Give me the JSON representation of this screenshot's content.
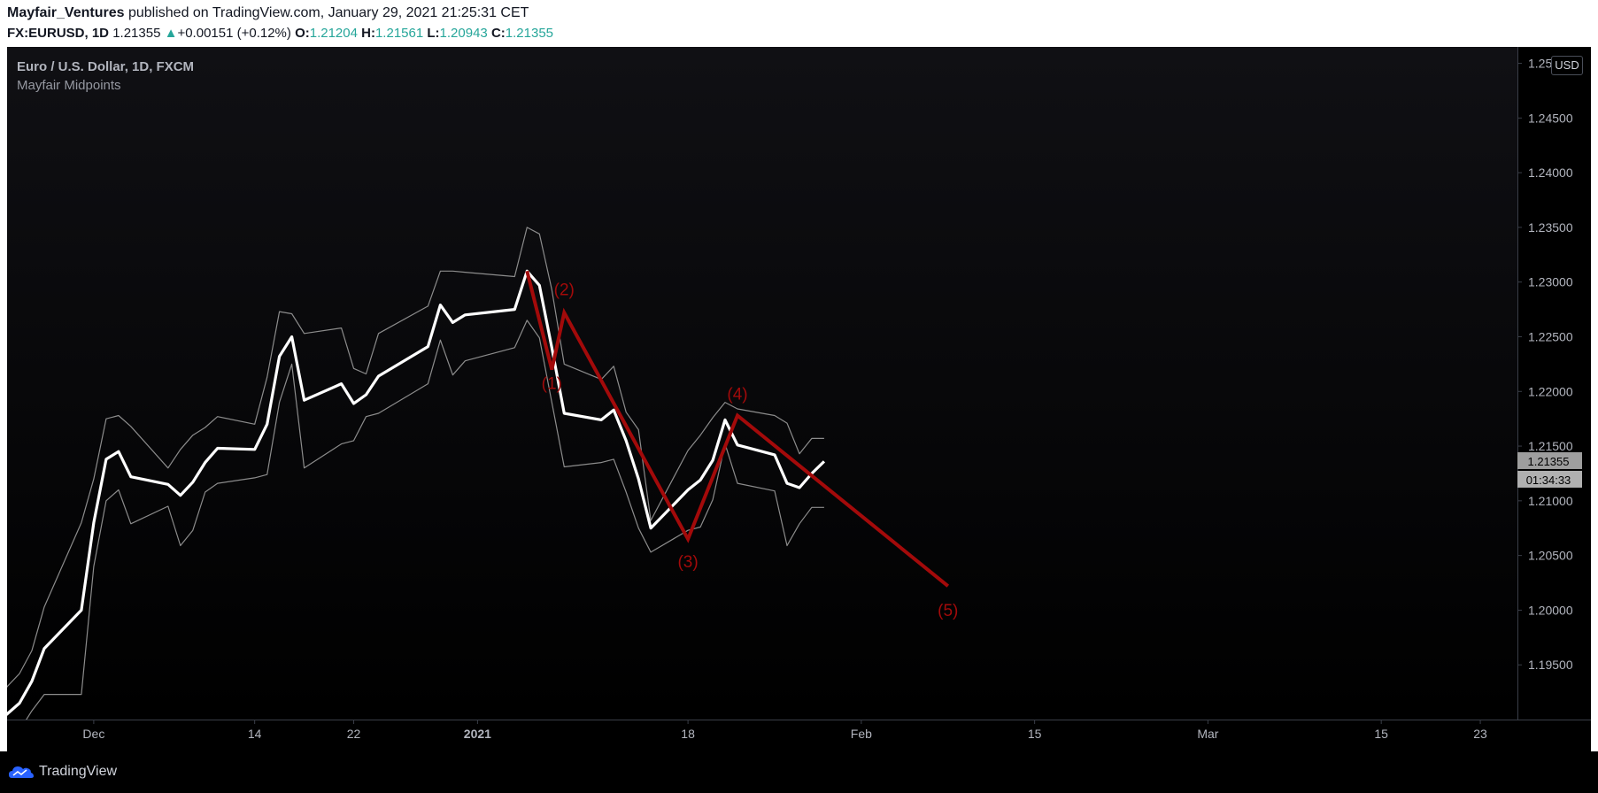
{
  "header": {
    "author": "Mayfair_Ventures",
    "published_text": " published on TradingView.com, January 29, 2021 21:25:31 CET",
    "symbol_text": "FX:EURUSD, 1D",
    "last": "1.21355",
    "change_arrow": "▲",
    "change": "+0.00151 (+0.12%)",
    "o_label": "O:",
    "o": "1.21204",
    "h_label": "H:",
    "h": "1.21561",
    "l_label": "L:",
    "l": "1.20943",
    "c_label": "C:",
    "c": "1.21355"
  },
  "legend": {
    "title": "Euro / U.S. Dollar, 1D, FXCM",
    "indicator": "Mayfair Midpoints"
  },
  "currency_badge": "USD",
  "price_label": "1.21355",
  "countdown_label": "01:34:33",
  "footer": {
    "brand": "TradingView"
  },
  "colors": {
    "background": "#000000",
    "midline": "#ffffff",
    "band": "#8c8c8c",
    "wave": "#a30a0a",
    "axis_text": "#b2b5be",
    "price_label_bg": "#9e9e9e",
    "countdown_bg": "#b0b0b0"
  },
  "chart_data": {
    "type": "line",
    "title": "",
    "xlabel": "",
    "ylabel": "",
    "ylim": [
      1.19,
      1.2515
    ],
    "date_range": [
      "2020-11-24",
      "2021-03-26"
    ],
    "y_ticks": [
      "1.19500",
      "1.20000",
      "1.20500",
      "1.21000",
      "1.21500",
      "1.22000",
      "1.22500",
      "1.23000",
      "1.23500",
      "1.24000",
      "1.24500",
      "1.25000"
    ],
    "x_ticks": [
      {
        "label": "Dec",
        "date": "2020-12-01",
        "bold": false
      },
      {
        "label": "14",
        "date": "2020-12-14",
        "bold": false
      },
      {
        "label": "22",
        "date": "2020-12-22",
        "bold": false
      },
      {
        "label": "2021",
        "date": "2021-01-01",
        "bold": true
      },
      {
        "label": "18",
        "date": "2021-01-18",
        "bold": false
      },
      {
        "label": "Feb",
        "date": "2021-02-01",
        "bold": false
      },
      {
        "label": "15",
        "date": "2021-02-15",
        "bold": false
      },
      {
        "label": "Mar",
        "date": "2021-03-01",
        "bold": false
      },
      {
        "label": "15",
        "date": "2021-03-15",
        "bold": false
      },
      {
        "label": "23",
        "date": "2021-03-23",
        "bold": false
      }
    ],
    "x": [
      "2020-11-20",
      "2020-11-23",
      "2020-11-24",
      "2020-11-25",
      "2020-11-26",
      "2020-11-27",
      "2020-11-30",
      "2020-12-01",
      "2020-12-02",
      "2020-12-03",
      "2020-12-04",
      "2020-12-07",
      "2020-12-08",
      "2020-12-09",
      "2020-12-10",
      "2020-12-11",
      "2020-12-14",
      "2020-12-15",
      "2020-12-16",
      "2020-12-17",
      "2020-12-18",
      "2020-12-21",
      "2020-12-22",
      "2020-12-23",
      "2020-12-24",
      "2020-12-28",
      "2020-12-29",
      "2020-12-30",
      "2020-12-31",
      "2021-01-04",
      "2021-01-05",
      "2021-01-06",
      "2021-01-07",
      "2021-01-08",
      "2021-01-11",
      "2021-01-12",
      "2021-01-13",
      "2021-01-14",
      "2021-01-15",
      "2021-01-18",
      "2021-01-19",
      "2021-01-20",
      "2021-01-21",
      "2021-01-22",
      "2021-01-25",
      "2021-01-26",
      "2021-01-27",
      "2021-01-28",
      "2021-01-29"
    ],
    "series": [
      {
        "values": [
          1.188,
          1.1895,
          1.1905,
          1.1915,
          1.1935,
          1.1965,
          1.2,
          1.208,
          1.2138,
          1.2145,
          1.2122,
          1.2115,
          1.2105,
          1.2117,
          1.2135,
          1.2148,
          1.2147,
          1.217,
          1.2232,
          1.225,
          1.2192,
          1.2207,
          1.2189,
          1.2197,
          1.2214,
          1.2241,
          1.2279,
          1.2263,
          1.227,
          1.2275,
          1.231,
          1.2297,
          1.224,
          1.218,
          1.2174,
          1.2183,
          1.2155,
          1.212,
          1.2075,
          1.211,
          1.2119,
          1.2137,
          1.2174,
          1.2151,
          1.2142,
          1.2116,
          1.2112,
          1.2125,
          1.2136
        ]
      },
      {
        "values": [
          1.1895,
          1.191,
          1.193,
          1.1942,
          1.1963,
          1.2003,
          1.208,
          1.212,
          1.2175,
          1.2178,
          1.2168,
          1.213,
          1.2147,
          1.216,
          1.2167,
          1.2177,
          1.217,
          1.2213,
          1.2273,
          1.2271,
          1.2253,
          1.2258,
          1.2221,
          1.2216,
          1.2253,
          1.2278,
          1.231,
          1.231,
          1.2309,
          1.2305,
          1.235,
          1.2344,
          1.2293,
          1.2225,
          1.2211,
          1.2223,
          1.2181,
          1.2165,
          1.2082,
          1.2146,
          1.216,
          1.2176,
          1.219,
          1.2184,
          1.2178,
          1.2171,
          1.2143,
          1.2157,
          1.2157
        ]
      },
      {
        "values": [
          1.1865,
          1.188,
          1.1883,
          1.189,
          1.1908,
          1.1923,
          1.1923,
          1.204,
          1.21,
          1.211,
          1.2079,
          1.2095,
          1.2059,
          1.2073,
          1.2108,
          1.2116,
          1.2121,
          1.2124,
          1.219,
          1.2225,
          1.213,
          1.2152,
          1.2155,
          1.2177,
          1.218,
          1.2207,
          1.2247,
          1.2215,
          1.2228,
          1.224,
          1.2265,
          1.2249,
          1.219,
          1.2131,
          1.2135,
          1.2138,
          1.2108,
          1.2075,
          1.2053,
          1.2073,
          1.2076,
          1.2101,
          1.2152,
          1.2116,
          1.2109,
          1.2059,
          1.2079,
          1.2094,
          1.2094
        ]
      }
    ],
    "annotations": [
      {
        "label": "(1)",
        "date": "2021-01-07",
        "value": 1.222
      },
      {
        "label": "(2)",
        "date": "2021-01-08",
        "value": 1.2272
      },
      {
        "label": "(3)",
        "date": "2021-01-18",
        "value": 1.2065
      },
      {
        "label": "(4)",
        "date": "2021-01-22",
        "value": 1.2178
      },
      {
        "label": "(5)",
        "date": "2021-02-08",
        "value": 1.2022
      }
    ],
    "wave_path": [
      {
        "date": "2021-01-05",
        "value": 1.231
      },
      {
        "date": "2021-01-07",
        "value": 1.222
      },
      {
        "date": "2021-01-08",
        "value": 1.2272
      },
      {
        "date": "2021-01-18",
        "value": 1.2065
      },
      {
        "date": "2021-01-22",
        "value": 1.2178
      },
      {
        "date": "2021-02-08",
        "value": 1.2022
      }
    ],
    "grid": false
  }
}
